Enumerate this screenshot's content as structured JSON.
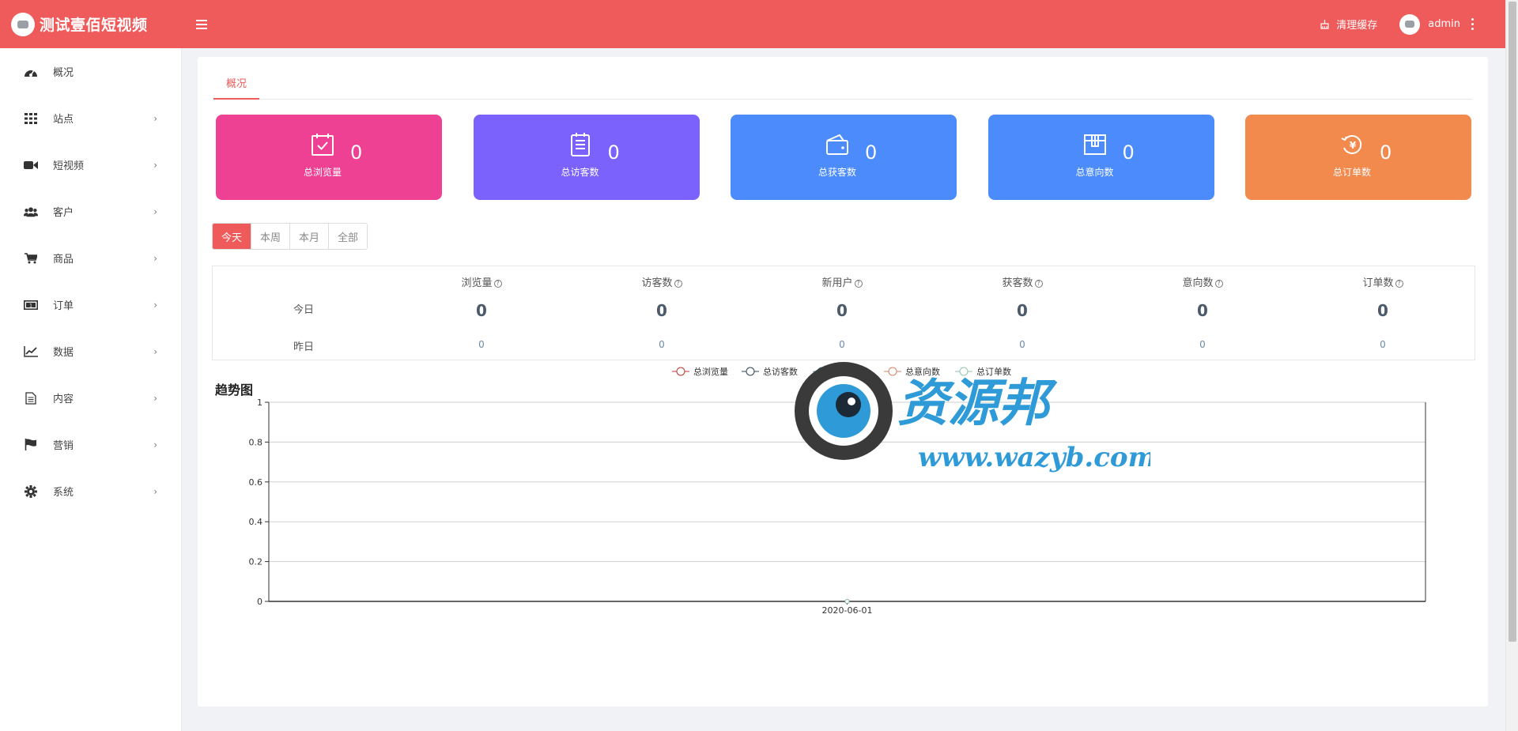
{
  "header": {
    "brand_title": "测试壹佰短视频",
    "clear_cache_label": "清理缓存",
    "username": "admin"
  },
  "sidebar": {
    "items": [
      {
        "label": "概况",
        "icon": "dashboard-icon",
        "has_children": false
      },
      {
        "label": "站点",
        "icon": "grid-icon",
        "has_children": true
      },
      {
        "label": "短视频",
        "icon": "video-camera-icon",
        "has_children": true
      },
      {
        "label": "客户",
        "icon": "users-icon",
        "has_children": true
      },
      {
        "label": "商品",
        "icon": "cart-icon",
        "has_children": true
      },
      {
        "label": "订单",
        "icon": "money-icon",
        "has_children": true
      },
      {
        "label": "数据",
        "icon": "line-chart-icon",
        "has_children": true
      },
      {
        "label": "内容",
        "icon": "document-icon",
        "has_children": true
      },
      {
        "label": "营销",
        "icon": "flag-icon",
        "has_children": true
      },
      {
        "label": "系统",
        "icon": "gear-icon",
        "has_children": true
      }
    ],
    "chevron": "›"
  },
  "tabs": {
    "active": "概况"
  },
  "cards": [
    {
      "label": "总浏览量",
      "value": "0",
      "color": "#ef4194",
      "icon": "checkbox-icon"
    },
    {
      "label": "总访客数",
      "value": "0",
      "color": "#7b62fc",
      "icon": "clipboard-icon"
    },
    {
      "label": "总获客数",
      "value": "0",
      "color": "#4b8bfb",
      "icon": "wallet-icon"
    },
    {
      "label": "总意向数",
      "value": "0",
      "color": "#4b8bfb",
      "icon": "box-icon"
    },
    {
      "label": "总订单数",
      "value": "0",
      "color": "#f28a4e",
      "icon": "yen-refresh-icon"
    }
  ],
  "range": {
    "options": [
      "今天",
      "本周",
      "本月",
      "全部"
    ],
    "active_index": 0
  },
  "stats": {
    "row_labels": {
      "today": "今日",
      "yesterday": "昨日"
    },
    "columns": [
      {
        "header": "浏览量",
        "today": "0",
        "yesterday": "0"
      },
      {
        "header": "访客数",
        "today": "0",
        "yesterday": "0"
      },
      {
        "header": "新用户",
        "today": "0",
        "yesterday": "0"
      },
      {
        "header": "获客数",
        "today": "0",
        "yesterday": "0"
      },
      {
        "header": "意向数",
        "today": "0",
        "yesterday": "0"
      },
      {
        "header": "订单数",
        "today": "0",
        "yesterday": "0"
      }
    ],
    "help_glyph": "?"
  },
  "watermark": {
    "text": "资源邦",
    "url": "www.wazyb.com"
  },
  "chart_data": {
    "type": "line",
    "title": "趋势图",
    "categories": [
      "2020-06-01"
    ],
    "series": [
      {
        "name": "总浏览量",
        "values": [
          0
        ],
        "color": "#c23531"
      },
      {
        "name": "总访客数",
        "values": [
          0
        ],
        "color": "#2f4554"
      },
      {
        "name": "总获客数",
        "values": [
          0
        ],
        "color": "#61a0a8"
      },
      {
        "name": "总意向数",
        "values": [
          0
        ],
        "color": "#d48265"
      },
      {
        "name": "总订单数",
        "values": [
          0
        ],
        "color": "#91c7ae"
      }
    ],
    "ylim": [
      0,
      1
    ],
    "yticks": [
      "0",
      "0.2",
      "0.4",
      "0.6",
      "0.8",
      "1"
    ],
    "grid": true,
    "legend": "top-center"
  }
}
